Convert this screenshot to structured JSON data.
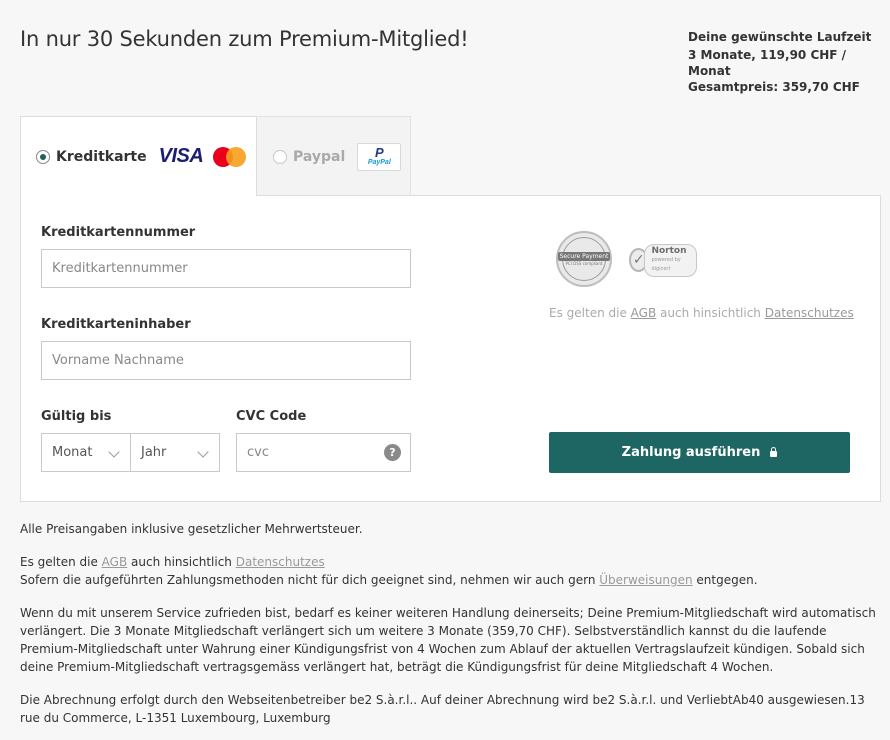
{
  "header": {
    "title": "In nur 30 Sekunden zum Premium-Mitglied!"
  },
  "summary": {
    "heading": "Deine gewünschte Laufzeit",
    "plan": "3 Monate, 119,90 CHF / Monat",
    "total": "Gesamtpreis: 359,70 CHF"
  },
  "tabs": {
    "card": {
      "label": "Kreditkarte",
      "visa": "VISA",
      "selected": true
    },
    "paypal": {
      "label": "Paypal",
      "logo_top": "P",
      "logo_word": "PayPal",
      "selected": false
    }
  },
  "form": {
    "card_number": {
      "label": "Kreditkartennummer",
      "placeholder": "Kreditkartennummer"
    },
    "holder": {
      "label": "Kreditkarteninhaber",
      "placeholder": "Vorname Nachname"
    },
    "valid": {
      "label": "Gültig bis",
      "month": "Monat",
      "year": "Jahr"
    },
    "cvc": {
      "label": "CVC Code",
      "placeholder": "cvc",
      "help": "?"
    }
  },
  "security": {
    "seal_band": "Secure Payment",
    "seal_small": "PCI DSS compliant",
    "norton_title": "Norton",
    "norton_sub": "powered by digicert"
  },
  "terms_inline": {
    "prefix": "Es gelten die",
    "agb": "AGB",
    "middle": "auch hinsichtlich",
    "privacy": "Datenschutzes"
  },
  "pay_button": {
    "label": "Zahlung ausführen"
  },
  "footer": {
    "vat": "Alle Preisangaben inklusive gesetzlicher Mehrwertsteuer.",
    "terms_prefix": "Es gelten die",
    "terms_agb": "AGB",
    "terms_middle": "auch hinsichtlich",
    "terms_privacy": "Datenschutzes",
    "alt_prefix": "Sofern die aufgeführten Zahlungsmethoden nicht für dich geeignet sind, nehmen wir auch gern",
    "alt_link": "Überweisungen",
    "alt_suffix": "entgegen.",
    "renewal": "Wenn du mit unserem Service zufrieden bist, bedarf es keiner weiteren Handlung deinerseits; Deine Premium-Mitgliedschaft wird automatisch verlängert. Die 3 Monate Mitgliedschaft verlängert sich um weitere 3 Monate (359,70 CHF). Selbstverständlich kannst du die laufende Premium-Mitgliedschaft unter Wahrung einer Kündigungsfrist von 4 Wochen zum Ablauf der aktuellen Vertragslaufzeit kündigen. Sobald sich deine Premium-Mitgliedschaft vertragsgemäss verlängert hat, beträgt die Kündigungsfrist für deine Mitgliedschaft 4 Wochen.",
    "billing": "Die Abrechnung erfolgt durch den Webseitenbetreiber be2 S.à.r.l.. Auf deiner Abrechnung wird be2 S.à.r.l. und VerliebtAb40 ausgewiesen.13 rue du Commerce, L-1351 Luxembourg, Luxemburg"
  },
  "colors": {
    "accent": "#1e6663",
    "background": "#f7f7f7"
  }
}
